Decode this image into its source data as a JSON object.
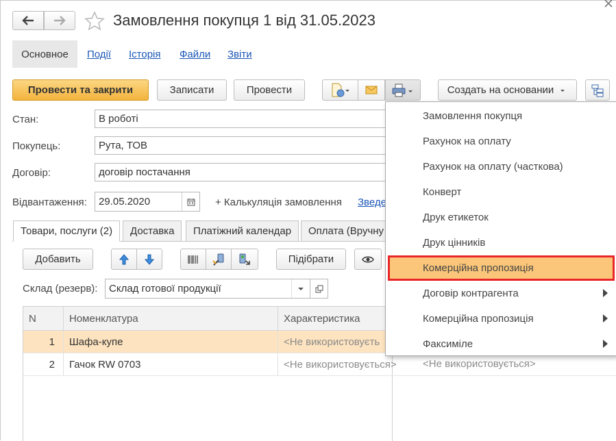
{
  "window": {
    "title": "Замовлення покупця 1 від 31.05.2023"
  },
  "nav_tabs": [
    "Основное",
    "Події",
    "Історія",
    "Файли",
    "Звіти"
  ],
  "toolbar": {
    "post_close": "Провести та закрити",
    "save": "Записати",
    "post": "Провести",
    "create_based": "Создать на основании"
  },
  "fields": {
    "state_label": "Стан:",
    "state_value": "В роботі",
    "customer_label": "Покупець:",
    "customer_value": "Рута, ТОВ",
    "contract_label": "Договір:",
    "contract_value": "договір постачання",
    "shipment_label": "Відвантаження:",
    "shipment_value": "29.05.2020",
    "calculation_link": "+ Калькуляція замовлення",
    "summary_link": "Зведе"
  },
  "doc_tabs": [
    "Товари, послуги (2)",
    "Доставка",
    "Платіжний календар",
    "Оплата (Вручну"
  ],
  "table_toolbar": {
    "add": "Добавить",
    "pick": "Підібрати"
  },
  "warehouse": {
    "label": "Склад (резерв):",
    "value": "Склад готової продукції"
  },
  "table": {
    "headers": [
      "N",
      "Номенклатура",
      "Характеристика"
    ],
    "rows": [
      {
        "n": "1",
        "item": "Шафа-купе",
        "char": "<Не використовуєть",
        "extra": ""
      },
      {
        "n": "2",
        "item": "Гачок RW 0703",
        "char": "<Не використовується>",
        "extra": "<Не використовується>"
      }
    ]
  },
  "print_menu": {
    "items": [
      {
        "label": "Замовлення покупця",
        "submenu": false
      },
      {
        "label": "Рахунок на оплату",
        "submenu": false
      },
      {
        "label": "Рахунок на оплату (часткова)",
        "submenu": false
      },
      {
        "label": "Конверт",
        "submenu": false
      },
      {
        "label": "Друк етикеток",
        "submenu": false
      },
      {
        "label": "Друк цінників",
        "submenu": false
      },
      {
        "label": "Комерційна пропозиція",
        "submenu": false,
        "highlighted": true
      },
      {
        "label": "Договір контрагента",
        "submenu": true
      },
      {
        "label": "Комерційна пропозиція",
        "submenu": true
      },
      {
        "label": "Факсиміле",
        "submenu": true
      }
    ]
  },
  "colors": {
    "primary_button": "#f3b33d",
    "link": "#1a55b6",
    "selected_row": "#fde3bf",
    "menu_highlight": "#fbc679",
    "highlight_border": "#e8262a"
  }
}
